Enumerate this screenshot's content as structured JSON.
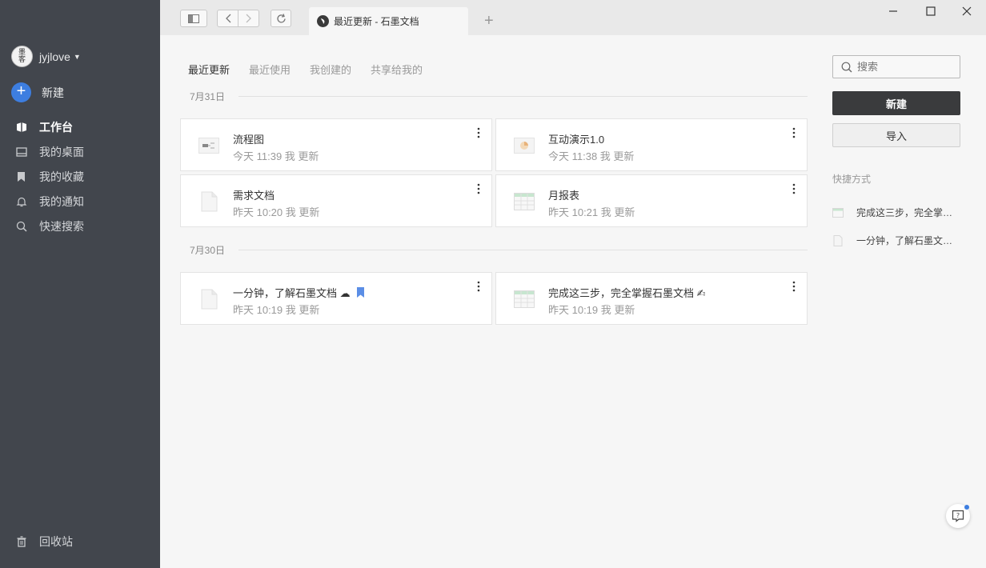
{
  "sidebar": {
    "username": "jyjlove",
    "avatar_text": [
      "墨",
      "客"
    ],
    "new_label": "新建",
    "items": [
      {
        "label": "工作台"
      },
      {
        "label": "我的桌面"
      },
      {
        "label": "我的收藏"
      },
      {
        "label": "我的通知"
      },
      {
        "label": "快速搜索"
      }
    ],
    "trash_label": "回收站"
  },
  "tab": {
    "title": "最近更新 - 石墨文档"
  },
  "filters": [
    "最近更新",
    "最近使用",
    "我创建的",
    "共享给我的"
  ],
  "groups": [
    {
      "date": "7月31日"
    },
    {
      "date": "7月30日"
    }
  ],
  "cards": [
    {
      "title": "流程图",
      "subtitle": "今天 11:39 我 更新",
      "icon": "flowchart-file-icon"
    },
    {
      "title": "互动演示1.0",
      "subtitle": "今天 11:38 我 更新",
      "icon": "slides-file-icon"
    },
    {
      "title": "需求文档",
      "subtitle": "昨天 10:20 我 更新",
      "icon": "doc-file-icon"
    },
    {
      "title": "月报表",
      "subtitle": "昨天 10:21 我 更新",
      "icon": "sheet-file-icon"
    },
    {
      "title": "一分钟，了解石墨文档 ☁",
      "subtitle": "昨天 10:19 我 更新",
      "icon": "doc-file-icon"
    },
    {
      "title": "完成这三步，完全掌握石墨文档 ✍",
      "subtitle": "昨天 10:19 我 更新",
      "icon": "sheet-file-icon"
    }
  ],
  "right": {
    "search_placeholder": "搜索",
    "new_button": "新建",
    "import_button": "导入",
    "shortcuts_heading": "快捷方式",
    "shortcuts": [
      {
        "label": "完成这三步，完全掌…",
        "icon": "sheet-file-icon"
      },
      {
        "label": "一分钟，了解石墨文…",
        "icon": "doc-file-icon"
      }
    ]
  },
  "colors": {
    "sidebar_bg": "#42464d",
    "accent": "#3d7ee0",
    "primary_button": "#3a3b3d"
  }
}
